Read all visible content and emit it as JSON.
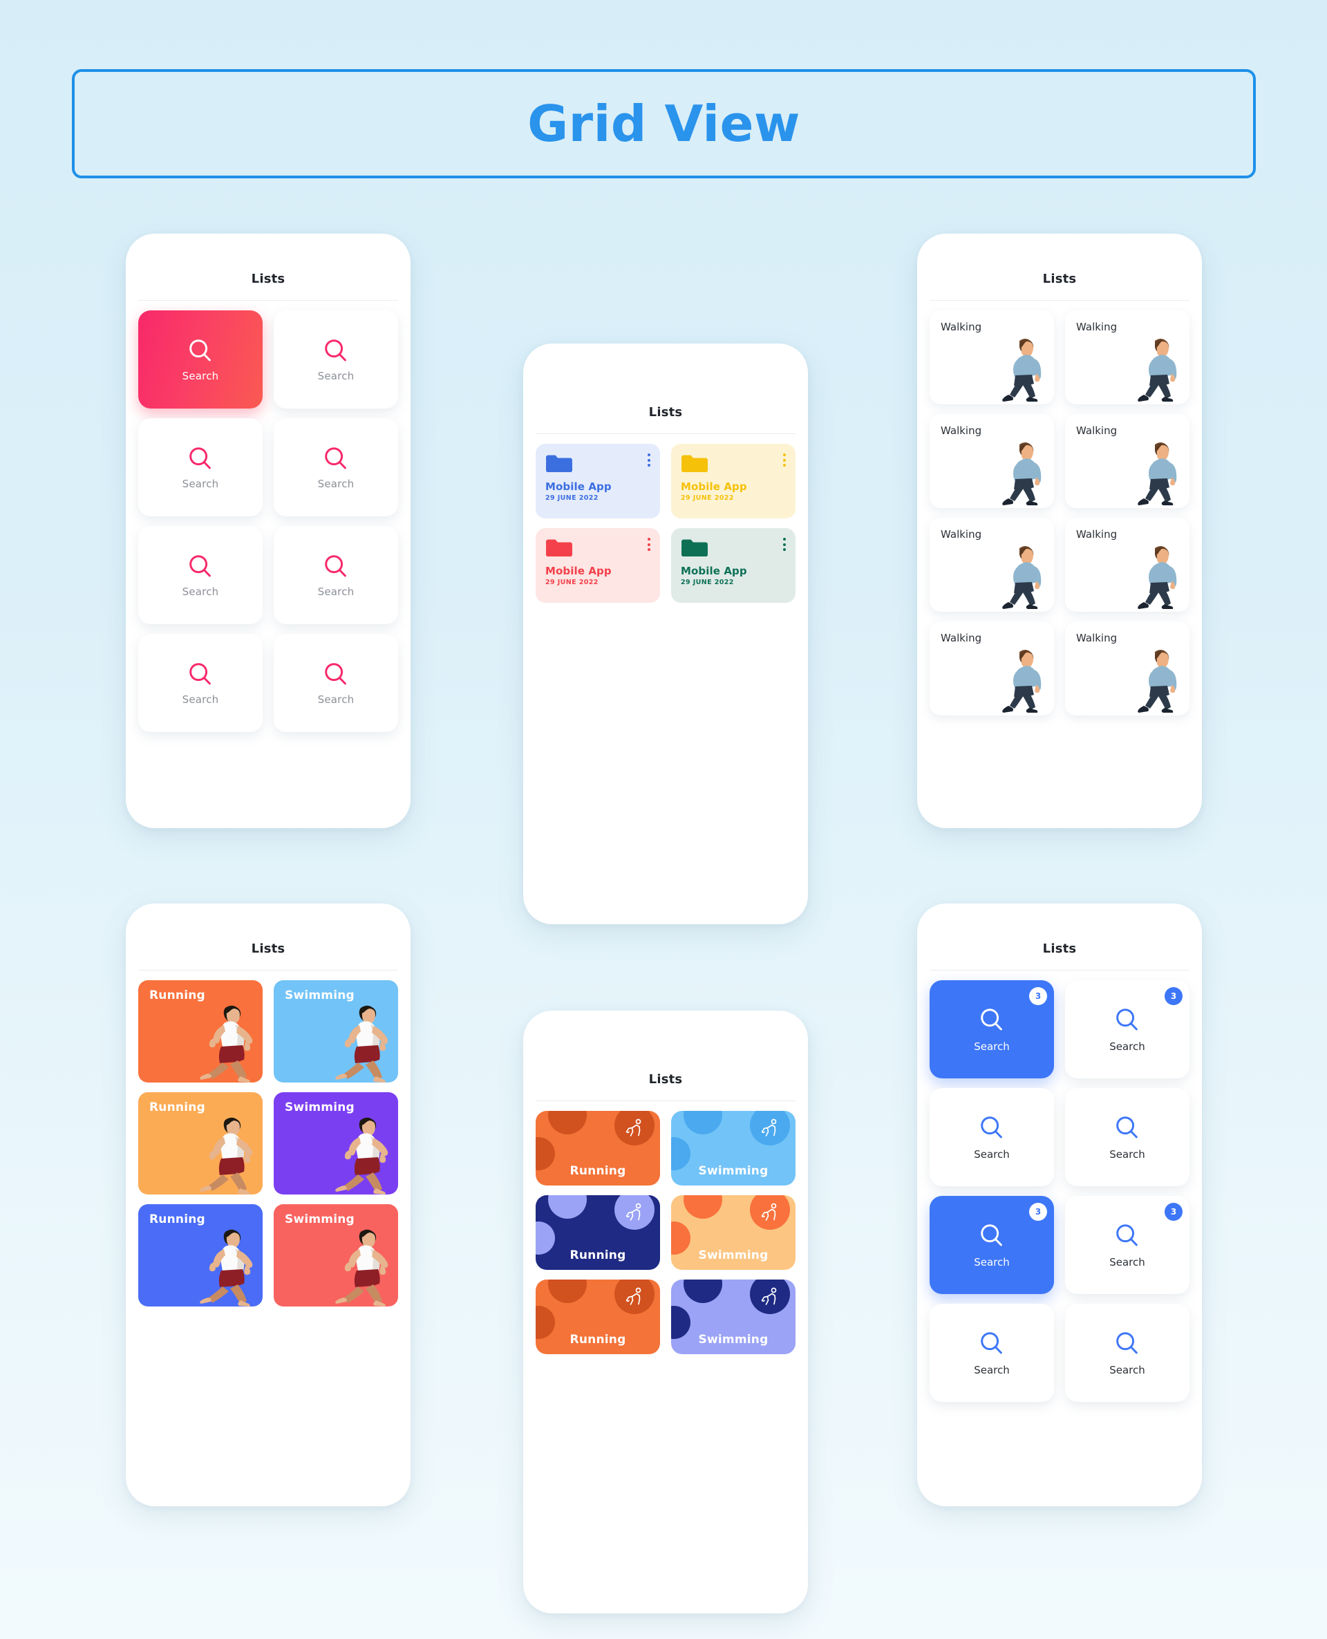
{
  "page": {
    "title": "Grid View",
    "background_top": "#d7eef8",
    "background_bottom": "#f2fafd",
    "title_color": "#2a93ec",
    "title_border_color": "#1e90e8"
  },
  "phone_search_pink": {
    "header_title": "Lists",
    "accent": "#f8286a",
    "cards": [
      {
        "label": "Search",
        "icon": "search-icon",
        "active": true
      },
      {
        "label": "Search",
        "icon": "search-icon",
        "active": false
      },
      {
        "label": "Search",
        "icon": "search-icon",
        "active": false
      },
      {
        "label": "Search",
        "icon": "search-icon",
        "active": false
      },
      {
        "label": "Search",
        "icon": "search-icon",
        "active": false
      },
      {
        "label": "Search",
        "icon": "search-icon",
        "active": false
      },
      {
        "label": "Search",
        "icon": "search-icon",
        "active": false
      },
      {
        "label": "Search",
        "icon": "search-icon",
        "active": false
      }
    ]
  },
  "phone_folders": {
    "header_title": "Lists",
    "cards": [
      {
        "name": "Mobile App",
        "date": "29 JUNE 2022",
        "icon": "folder-icon",
        "menu_icon": "kebab-menu-icon",
        "color": "#3b6fe0",
        "bg": "#e4ebfb"
      },
      {
        "name": "Mobile App",
        "date": "29 JUNE 2022",
        "icon": "folder-icon",
        "menu_icon": "kebab-menu-icon",
        "color": "#f5c109",
        "bg": "#fdf3d3"
      },
      {
        "name": "Mobile App",
        "date": "29 JUNE 2022",
        "icon": "folder-icon",
        "menu_icon": "kebab-menu-icon",
        "color": "#f4404a",
        "bg": "#fde6e4"
      },
      {
        "name": "Mobile App",
        "date": "29 JUNE 2022",
        "icon": "folder-icon",
        "menu_icon": "kebab-menu-icon",
        "color": "#0d7055",
        "bg": "#e0ebe7"
      }
    ]
  },
  "phone_walking": {
    "header_title": "Lists",
    "cards": [
      {
        "label": "Walking",
        "icon": "walking-person-illustration"
      },
      {
        "label": "Walking",
        "icon": "walking-person-illustration"
      },
      {
        "label": "Walking",
        "icon": "walking-person-illustration"
      },
      {
        "label": "Walking",
        "icon": "walking-person-illustration"
      },
      {
        "label": "Walking",
        "icon": "walking-person-illustration"
      },
      {
        "label": "Walking",
        "icon": "walking-person-illustration"
      },
      {
        "label": "Walking",
        "icon": "walking-person-illustration"
      },
      {
        "label": "Walking",
        "icon": "walking-person-illustration"
      }
    ]
  },
  "phone_sport_photo": {
    "header_title": "Lists",
    "cards": [
      {
        "label": "Running",
        "bg": "#f9713c",
        "icon": "running-person-illustration"
      },
      {
        "label": "Swimming",
        "bg": "#72c3f7",
        "icon": "running-person-illustration"
      },
      {
        "label": "Running",
        "bg": "#fcab55",
        "icon": "running-person-illustration"
      },
      {
        "label": "Swimming",
        "bg": "#7b3ff2",
        "icon": "running-person-illustration"
      },
      {
        "label": "Running",
        "bg": "#4a6cf7",
        "icon": "running-person-illustration"
      },
      {
        "label": "Swimming",
        "bg": "#f9635f",
        "icon": "running-person-illustration"
      }
    ]
  },
  "phone_sport_chip": {
    "header_title": "Lists",
    "cards": [
      {
        "label": "Running",
        "bg": "#f37338",
        "blob": "#d1511f",
        "badge_bg": "#d1511f",
        "icon": "running-figure-icon"
      },
      {
        "label": "Swimming",
        "bg": "#72c3f7",
        "blob": "#4aa9ef",
        "badge_bg": "#4aa9ef",
        "icon": "running-figure-icon"
      },
      {
        "label": "Running",
        "bg": "#1e2a83",
        "blob": "#9aa3f5",
        "badge_bg": "#9aa3f5",
        "icon": "running-figure-icon"
      },
      {
        "label": "Swimming",
        "bg": "#fcc582",
        "blob": "#f9713c",
        "badge_bg": "#f9713c",
        "icon": "running-figure-icon"
      },
      {
        "label": "Running",
        "bg": "#f37338",
        "blob": "#d1511f",
        "badge_bg": "#d1511f",
        "icon": "running-figure-icon"
      },
      {
        "label": "Swimming",
        "bg": "#9aa3f5",
        "blob": "#1e2a83",
        "badge_bg": "#1e2a83",
        "icon": "running-figure-icon"
      }
    ]
  },
  "phone_search_blue": {
    "header_title": "Lists",
    "accent": "#3d76f7",
    "cards": [
      {
        "label": "Search",
        "icon": "search-icon",
        "active": true,
        "badge": "3"
      },
      {
        "label": "Search",
        "icon": "search-icon",
        "active": false,
        "badge": "3"
      },
      {
        "label": "Search",
        "icon": "search-icon",
        "active": false,
        "badge": ""
      },
      {
        "label": "Search",
        "icon": "search-icon",
        "active": false,
        "badge": ""
      },
      {
        "label": "Search",
        "icon": "search-icon",
        "active": true,
        "badge": "3"
      },
      {
        "label": "Search",
        "icon": "search-icon",
        "active": false,
        "badge": "3"
      },
      {
        "label": "Search",
        "icon": "search-icon",
        "active": false,
        "badge": ""
      },
      {
        "label": "Search",
        "icon": "search-icon",
        "active": false,
        "badge": ""
      }
    ]
  }
}
